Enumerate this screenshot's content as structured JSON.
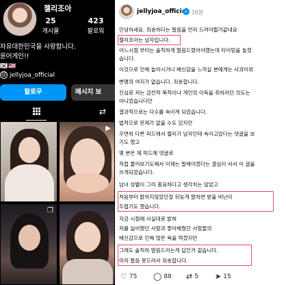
{
  "profile": {
    "name": "젤리조아",
    "stats": [
      {
        "num": "25",
        "label": "게시물"
      },
      {
        "num": "423",
        "label": "팔로워"
      }
    ],
    "bio": [
      "자유대한민국을 사랑합니다.",
      "윤어게인!!"
    ],
    "flags": "🇰🇷🇺🇸",
    "threads_handle": "jellyjoa_official",
    "follow_label": "팔로우",
    "message_label": "메시지 보"
  },
  "post": {
    "username": "jellyjoa_official",
    "time": "38분",
    "lines": [
      "안녕하세요. 죄송하다는 말씀을 먼저 드려야할거같네요",
      "젤리조아는 남자입니다.",
      "어느시점 부터는 솔직하게 말씀드렸어야했는데 타이밍을 놓쳤",
      "습니다.",
      "이것으로 인해 놀라시거나 배신감을 느끼실 분에게는 사과이외",
      "변명의 여지가 없습니다. 죄송합니다.",
      "진심로 저는 금전적 목적이나 개인의 이득을 취하려던 의도는",
      "아니었습니다만",
      "결과적으로는 다수를 속이게 되었습니다.",
      "법적으로 문제가 없을 수도 있지만",
      "우연히 다른 피드에서 젤리가 남자인데 속이고있다는 댓글을 보",
      "기도 했고",
      "몇 분은 제 피드에 댓글로",
      "직접 물어보기도해서 이제는 말해야겠다는 결심이 서서 이 글을",
      "쓰게되었습니다.",
      "남녀 성별이 그리 중요하다고 생각치는 않았고",
      "처음부터 밝히지않았던걸 뒤늦게 말하면 받을 비난이",
      "두렵기도 했습니다.",
      "지금 시점에 사실대로 밝혀",
      "저를 싫어했던 사람과 좋아해줬던 사람들의",
      "배신감으로 인해 많은 욕을 먹겠지만",
      "그래도 솔직히 말씀드리는게 답인거 같습니다.",
      "미리 말씀 못드려서 죄송합니다."
    ],
    "likes": "75",
    "comments": "88",
    "reposts": "5",
    "shares": "15"
  }
}
